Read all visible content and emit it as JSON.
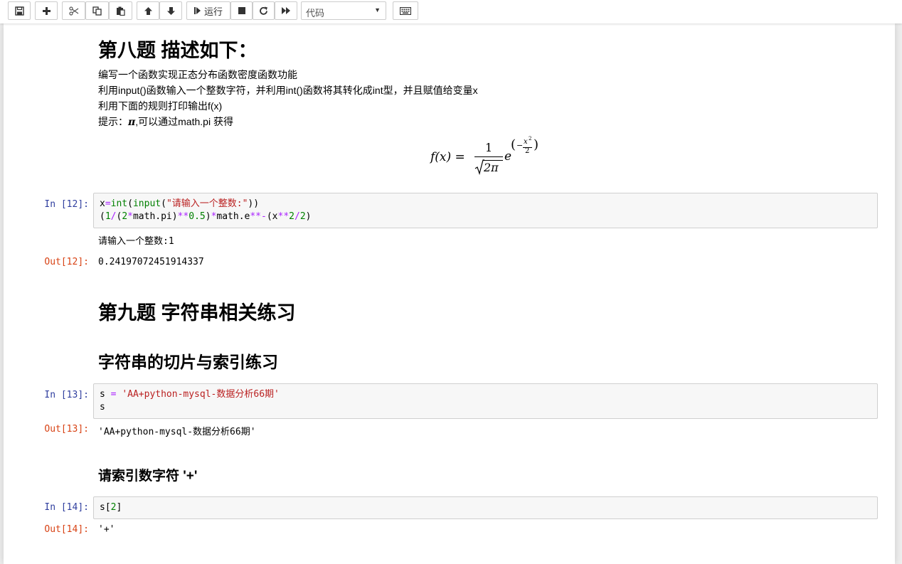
{
  "toolbar": {
    "run_label": "运行",
    "cell_type": "代码"
  },
  "cells": {
    "q8_heading": "第八题 描述如下：",
    "q8_lines": [
      "编写一个函数实现正态分布函数密度函数功能",
      "利用input()函数输入一个整数字符，并利用int()函数将其转化成int型，并且赋值给变量x",
      "利用下面的规则打印输出f(x)",
      "提示：",
      "π",
      ",可以通过math.pi 获得"
    ],
    "formula": {
      "lhs": "f(x) =",
      "numerator": "1",
      "denominator": "2π",
      "base": "e",
      "exponent": "−",
      "exp_num": "x",
      "exp_sup": "2",
      "exp_den": "2"
    },
    "in12": {
      "prompt": "In  [12]:",
      "code_line1": [
        "x",
        "=",
        "int",
        "(",
        "input",
        "(",
        "\"请输入一个整数:\"",
        "))"
      ],
      "code_line2": [
        "(",
        "1",
        "/",
        "(",
        "2",
        "*",
        "math.pi)",
        "**",
        "0.5",
        ")",
        "*",
        "math.e",
        "**",
        "-",
        "(x",
        "**",
        "2",
        "/",
        "2",
        ")"
      ],
      "stdout": "请输入一个整数:1"
    },
    "out12": {
      "prompt": "Out[12]:",
      "value": "0.24197072451914337"
    },
    "q9_heading": "第九题 字符串相关练习",
    "sub_heading": "字符串的切片与索引练习",
    "in13": {
      "prompt": "In  [13]:",
      "code_line1": [
        "s ",
        "=",
        " ",
        "'AA+python-mysql-数据分析66期'"
      ],
      "code_line2": "s"
    },
    "out13": {
      "prompt": "Out[13]:",
      "value": "'AA+python-mysql-数据分析66期'"
    },
    "index_heading": "请索引数字符 '+'",
    "in14": {
      "prompt": "In  [14]:",
      "code": [
        "s",
        "[",
        "2",
        "]"
      ]
    },
    "out14": {
      "prompt": "Out[14]:",
      "value": "'+'"
    }
  }
}
